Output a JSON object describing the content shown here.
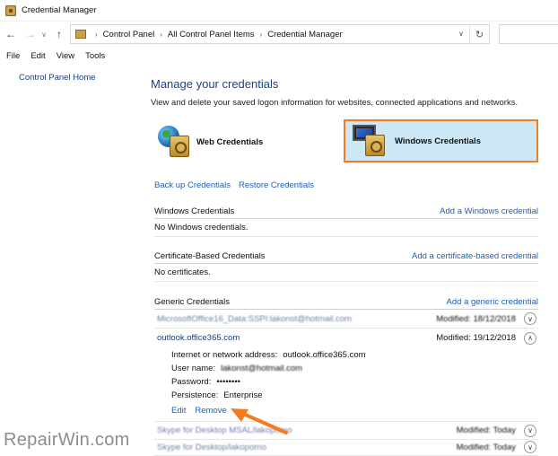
{
  "window": {
    "title": "Credential Manager"
  },
  "address": {
    "crumbs": [
      "Control Panel",
      "All Control Panel Items",
      "Credential Manager"
    ]
  },
  "menu": [
    "File",
    "Edit",
    "View",
    "Tools"
  ],
  "sidebar": {
    "home_link": "Control Panel Home"
  },
  "main": {
    "title": "Manage your credentials",
    "description": "View and delete your saved logon information for websites, connected applications and networks.",
    "tiles": {
      "web": "Web Credentials",
      "windows": "Windows Credentials"
    },
    "backup_link": "Back up Credentials",
    "restore_link": "Restore Credentials",
    "sections": {
      "windows": {
        "title": "Windows Credentials",
        "action": "Add a Windows credential",
        "empty": "No Windows credentials."
      },
      "certificate": {
        "title": "Certificate-Based Credentials",
        "action": "Add a certificate-based credential",
        "empty": "No certificates."
      },
      "generic": {
        "title": "Generic Credentials",
        "action": "Add a generic credential"
      }
    },
    "generic_items": [
      {
        "name": "MicrosoftOffice16_Data:SSPI:lakonst@hotmail.com",
        "modified": "Modified:  18/12/2018"
      },
      {
        "name": "outlook.office365.com",
        "modified": "Modified:  19/12/2018"
      },
      {
        "name": "Skype for Desktop MSAL/lakoporno",
        "modified": "Modified:  Today"
      },
      {
        "name": "Skype for Desktop/lakoporno",
        "modified": "Modified:  Today"
      }
    ],
    "details": {
      "address_label": "Internet or network address:",
      "address_value": "outlook.office365.com",
      "user_label": "User name:",
      "user_value": "lakonst@hotmail.com",
      "password_label": "Password:",
      "password_value": "••••••••",
      "persistence_label": "Persistence:",
      "persistence_value": "Enterprise",
      "edit": "Edit",
      "remove": "Remove"
    }
  },
  "watermark": "RepairWin.com",
  "colors": {
    "accent_link": "#1f5fb0",
    "highlight": "#f47b20",
    "selected_tile": "#cce8f7"
  }
}
